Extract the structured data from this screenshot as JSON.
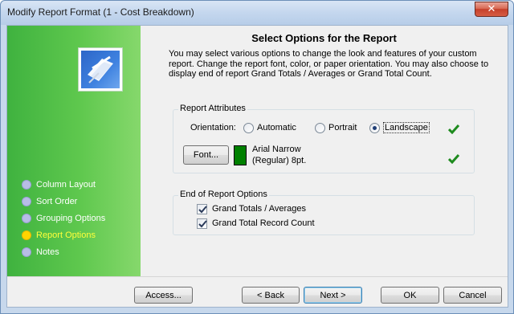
{
  "window": {
    "title": "Modify Report Format (1 - Cost Breakdown)",
    "close_symbol": "✕"
  },
  "sidebar": {
    "logo_icon": "report-format-icon",
    "steps": [
      {
        "label": "Column Layout",
        "active": false
      },
      {
        "label": "Sort Order",
        "active": false
      },
      {
        "label": "Grouping Options",
        "active": false
      },
      {
        "label": "Report Options",
        "active": true
      },
      {
        "label": "Notes",
        "active": false
      }
    ]
  },
  "main": {
    "heading": "Select Options for the Report",
    "intro": "You may select various options to change the look and features of your custom report.  Change the report font, color, or paper orientation. You may also choose to display end of report Grand Totals / Averages or Grand Total Count.",
    "report_attributes": {
      "title": "Report Attributes",
      "orientation_label": "Orientation:",
      "options": [
        "Automatic",
        "Portrait",
        "Landscape"
      ],
      "selected": "Landscape",
      "font_button": "Font...",
      "font_color": "#008000",
      "font_name": "Arial Narrow",
      "font_style": "(Regular) 8pt.",
      "status_icon": "green-check-icon"
    },
    "end_options": {
      "title": "End of Report Options",
      "items": [
        {
          "label": "Grand Totals / Averages",
          "checked": true
        },
        {
          "label": "Grand Total Record Count",
          "checked": true
        }
      ]
    }
  },
  "footer": {
    "access": "Access...",
    "back": "< Back",
    "next": "Next >",
    "ok": "OK",
    "cancel": "Cancel"
  },
  "colors": {
    "sidebar_green": "#4cbc44",
    "active_step": "#ffff3a",
    "check_green": "#1e8b1e"
  }
}
